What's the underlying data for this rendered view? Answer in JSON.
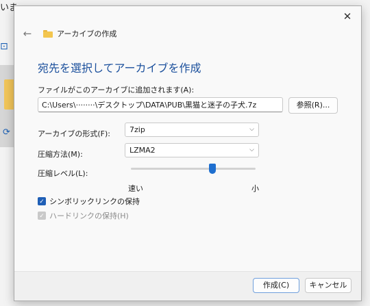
{
  "background": {
    "title_fragment": "いま"
  },
  "dialog": {
    "title": "アーカイブの作成",
    "heading": "宛先を選択してアーカイブを作成",
    "archive_path_label": "ファイルがこのアーカイブに追加されます(A):",
    "archive_path_value": "C:\\Users\\········\\デスクトップ\\DATA\\PUB\\黒猫と迷子の子犬.7z",
    "browse_label": "参照(R)...",
    "format_label": "アーカイブの形式(F):",
    "format_value": "7zip",
    "method_label": "圧縮方法(M):",
    "method_value": "LZMA2",
    "level_label": "圧縮レベル(L):",
    "level_fraction": 0.66,
    "level_min_label": "速い",
    "level_max_label": "小",
    "symlink_label": "シンボリックリンクの保持",
    "symlink_checked": true,
    "hardlink_label": "ハードリンクの保持(H)",
    "hardlink_checked": true,
    "hardlink_enabled": false,
    "create_label": "作成(C)",
    "cancel_label": "キャンセル"
  },
  "icons": {
    "close": "close-icon",
    "back": "back-arrow-icon",
    "folder": "folder-icon",
    "chevron": "chevron-down-icon",
    "check": "check-icon"
  },
  "colors": {
    "accent": "#1f5fb6",
    "heading": "#1a4f9c",
    "folder": "#f3c64f"
  }
}
